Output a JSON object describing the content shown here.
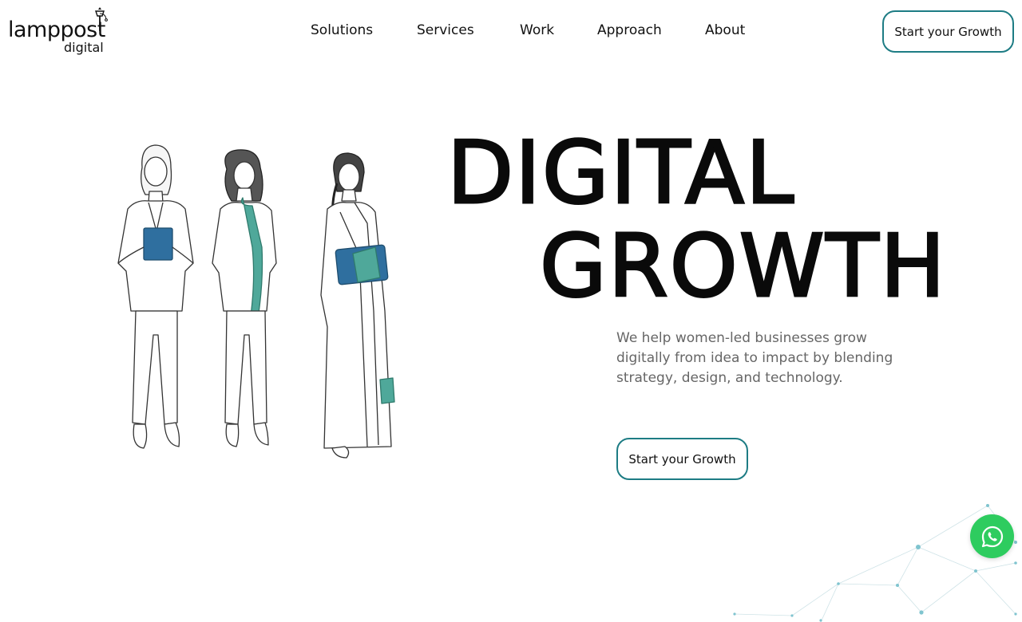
{
  "brand": {
    "name": "lamppost",
    "sub": "digital",
    "icon": "lamppost-icon"
  },
  "nav": {
    "items": [
      {
        "label": "Solutions"
      },
      {
        "label": "Services"
      },
      {
        "label": "Work"
      },
      {
        "label": "Approach"
      },
      {
        "label": "About"
      }
    ],
    "cta_label": "Start your Growth"
  },
  "hero": {
    "title_line1": "DIGITAL",
    "title_line2": "GROWTH",
    "description": "We help women-led businesses grow digitally from idea to impact by blending strategy, design, and technology.",
    "cta_label": "Start your Growth"
  },
  "colors": {
    "accent": "#1d7c84",
    "teal_garment": "#4fa89a",
    "device_blue": "#2f6f9f",
    "whatsapp_green": "#2ecc5f",
    "network_dot": "#7fc4cf"
  },
  "floating": {
    "whatsapp_icon": "whatsapp-icon"
  }
}
